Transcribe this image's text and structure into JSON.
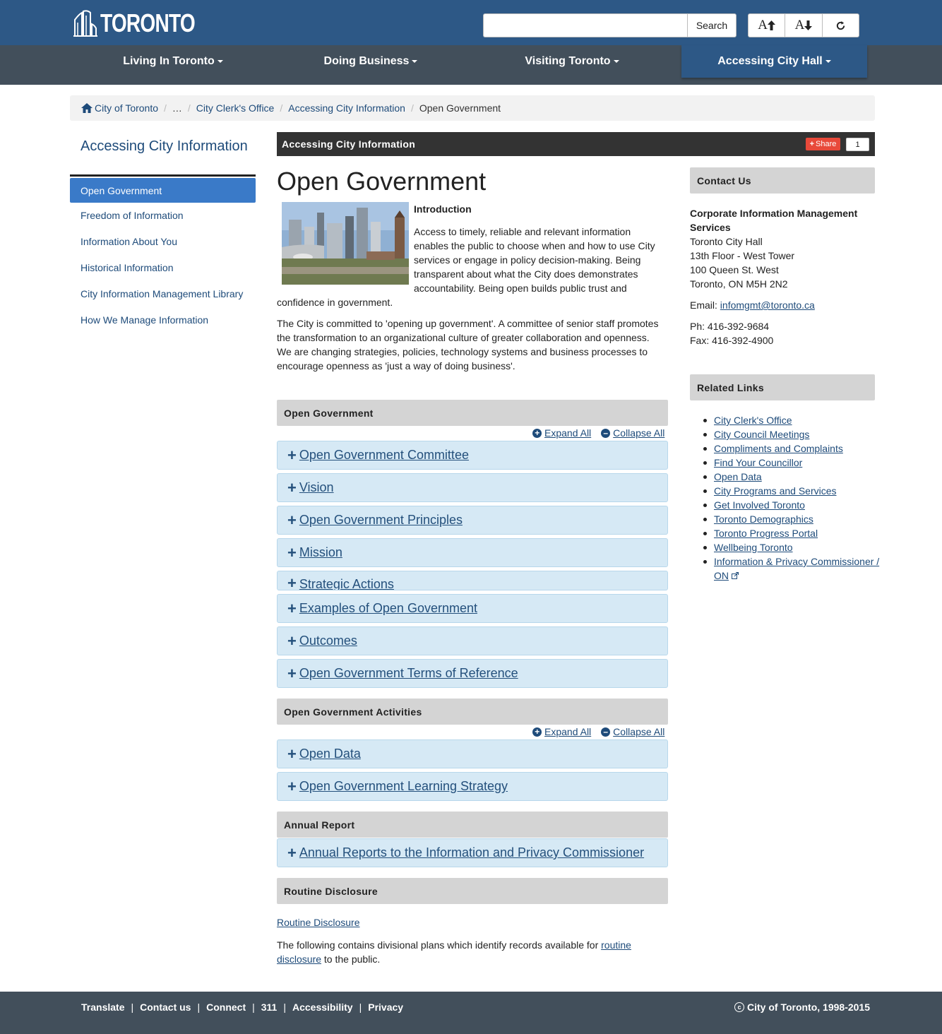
{
  "header": {
    "logo_text": "TORONTO",
    "search_placeholder": "",
    "search_button": "Search",
    "text_increase": "A",
    "text_decrease": "A",
    "reset_icon": "refresh-icon"
  },
  "nav": {
    "items": [
      {
        "label": "Living In Toronto"
      },
      {
        "label": "Doing Business"
      },
      {
        "label": "Visiting Toronto"
      },
      {
        "label": "Accessing City Hall"
      }
    ]
  },
  "breadcrumb": {
    "home": "City of Toronto",
    "ellipsis": "…",
    "items": [
      "City Clerk's Office",
      "Accessing City Information"
    ],
    "current": "Open Government"
  },
  "sidebar": {
    "title": "Accessing City Information",
    "items": [
      {
        "label": "Open Government"
      },
      {
        "label": "Freedom of Information"
      },
      {
        "label": "Information About You"
      },
      {
        "label": "Historical Information"
      },
      {
        "label": "City Information Management Library"
      },
      {
        "label": "How We Manage Information"
      }
    ]
  },
  "main": {
    "section_title": "Accessing City Information",
    "share_label": "Share",
    "share_count": "1",
    "page_title": "Open Government",
    "intro_heading": "Introduction",
    "intro_text": "Access to timely, reliable and relevant information enables the public to choose when and how to use City services or engage in policy decision-making.  Being transparent about what the City does demonstrates accountability.  Being open builds public trust and confidence in government.",
    "body_text": "The City is committed to 'opening up government'.  A committee of senior staff promotes the transformation to an organizational culture of greater collaboration and openness.  We are changing strategies, policies, technology systems and business processes to encourage openness as 'just a way of doing business'.",
    "expand_all": "Expand All",
    "collapse_all": "Collapse All",
    "groups": [
      {
        "title": "Open Government",
        "items": [
          "Open Government Committee",
          "Vision",
          "Open Government Principles",
          "Mission",
          "Strategic Actions",
          "Examples of Open Government",
          "Outcomes",
          "Open Government Terms of Reference"
        ]
      },
      {
        "title": "Open Government Activities",
        "items": [
          "Open Data",
          "Open Government Learning Strategy"
        ]
      },
      {
        "title": "Annual Report",
        "items": [
          "Annual Reports to the Information and Privacy Commissioner"
        ]
      },
      {
        "title": "Routine Disclosure",
        "items": []
      }
    ],
    "routine_link": "Routine Disclosure",
    "routine_text_before": "The following contains divisional plans which identify records available for ",
    "routine_text_link": "routine disclosure",
    "routine_text_after": " to the public."
  },
  "contact": {
    "header": "Contact Us",
    "org": "Corporate Information Management Services",
    "address": [
      "Toronto City Hall",
      "13th Floor - West Tower",
      "100 Queen St. West",
      "Toronto, ON M5H 2N2"
    ],
    "email_label": "Email: ",
    "email": "infomgmt@toronto.ca",
    "phone": "Ph: 416-392-9684",
    "fax": "Fax: 416-392-4900"
  },
  "related": {
    "header": "Related Links",
    "links": [
      "City Clerk's Office",
      "City Council Meetings",
      "Compliments and Complaints",
      "Find Your Councillor",
      "Open Data",
      "City Programs and Services",
      "Get Involved Toronto",
      "Toronto Demographics",
      "Toronto Progress Portal",
      "Wellbeing Toronto",
      "Information & Privacy Commissioner / ON"
    ]
  },
  "footer": {
    "links": [
      "Translate",
      "Contact us",
      "Connect",
      "311",
      "Accessibility",
      "Privacy"
    ],
    "copyright": "City of Toronto, 1998-2015"
  },
  "colors": {
    "header_blue": "#2d5886",
    "nav_grey": "#424f5b",
    "accordion_bg": "#d6e9f5",
    "active_sidebar": "#3a7ac8",
    "share_red": "#e8493a"
  }
}
